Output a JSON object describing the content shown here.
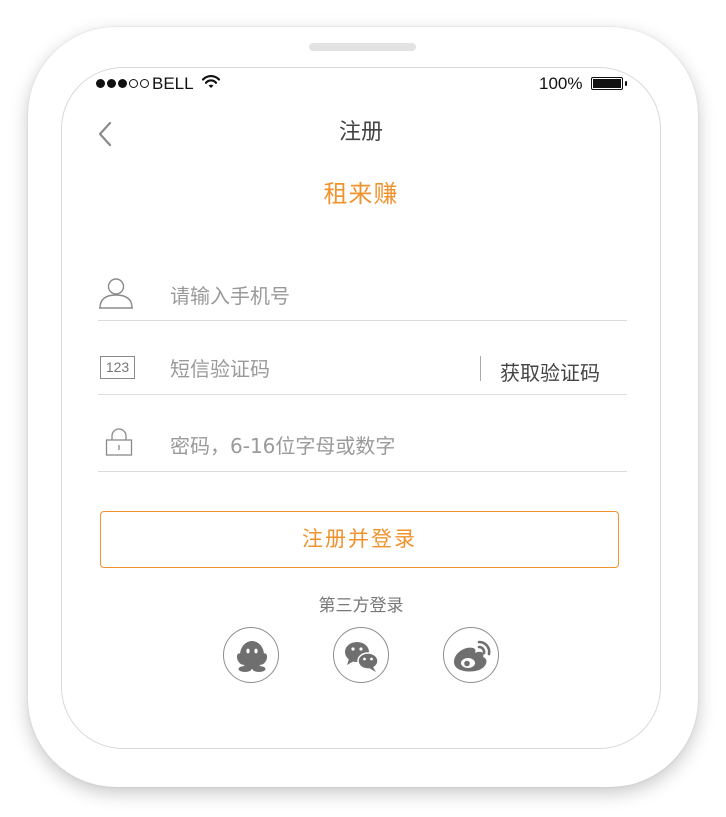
{
  "status_bar": {
    "carrier": "BELL",
    "battery": "100%",
    "signal_bars_filled": 3,
    "signal_bars_total": 5
  },
  "nav": {
    "title": "注册",
    "back_icon": "chevron-left-icon"
  },
  "brand": {
    "name": "租来赚",
    "color": "#f0922d"
  },
  "form": {
    "phone": {
      "icon": "user-icon",
      "placeholder": "请输入手机号",
      "value": ""
    },
    "sms": {
      "icon_text": "123",
      "placeholder": "短信验证码",
      "value": "",
      "get_code_label": "获取验证码"
    },
    "password": {
      "icon": "lock-icon",
      "placeholder": "密码，6-16位字母或数字",
      "value": ""
    }
  },
  "register_button": {
    "label": "注册并登录"
  },
  "third_party": {
    "title": "第三方登录",
    "providers": [
      {
        "icon": "qq-icon"
      },
      {
        "icon": "wechat-icon"
      },
      {
        "icon": "weibo-icon"
      }
    ]
  }
}
